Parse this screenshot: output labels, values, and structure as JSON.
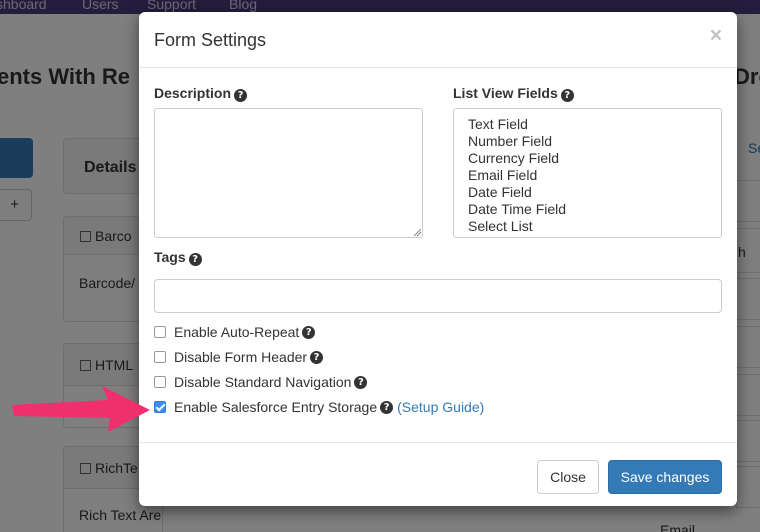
{
  "background": {
    "nav": [
      "shboard",
      "Users",
      "Support",
      "Blog"
    ],
    "title_left": "ents With Re",
    "title_right": "Dro",
    "plus_label": "+",
    "details_label": "Details",
    "panels": [
      {
        "head": "Barco",
        "body": "Barcode/"
      },
      {
        "head": "HTML",
        "body": ""
      },
      {
        "head": "RichTe",
        "body": "Rich Text Area"
      }
    ],
    "right_link": "Se",
    "right_text_1": "h",
    "right_text_2": "Email"
  },
  "modal": {
    "title": "Form Settings",
    "close_glyph": "×",
    "description_label": "Description",
    "list_view_label": "List View Fields",
    "list_view_options": [
      "Text Field",
      "Number Field",
      "Currency Field",
      "Email Field",
      "Date Field",
      "Date Time Field",
      "Select List"
    ],
    "tags_label": "Tags",
    "help_glyph": "?",
    "checkboxes": [
      {
        "label": "Enable Auto-Repeat",
        "checked": false
      },
      {
        "label": "Disable Form Header",
        "checked": false
      },
      {
        "label": "Disable Standard Navigation",
        "checked": false
      },
      {
        "label": "Enable Salesforce Entry Storage",
        "checked": true
      }
    ],
    "setup_guide_link": "(Setup Guide)",
    "close_button": "Close",
    "save_button": "Save changes"
  },
  "colors": {
    "primary": "#337ab7",
    "arrow": "#f0306e",
    "navbar": "#4a3a7a"
  }
}
